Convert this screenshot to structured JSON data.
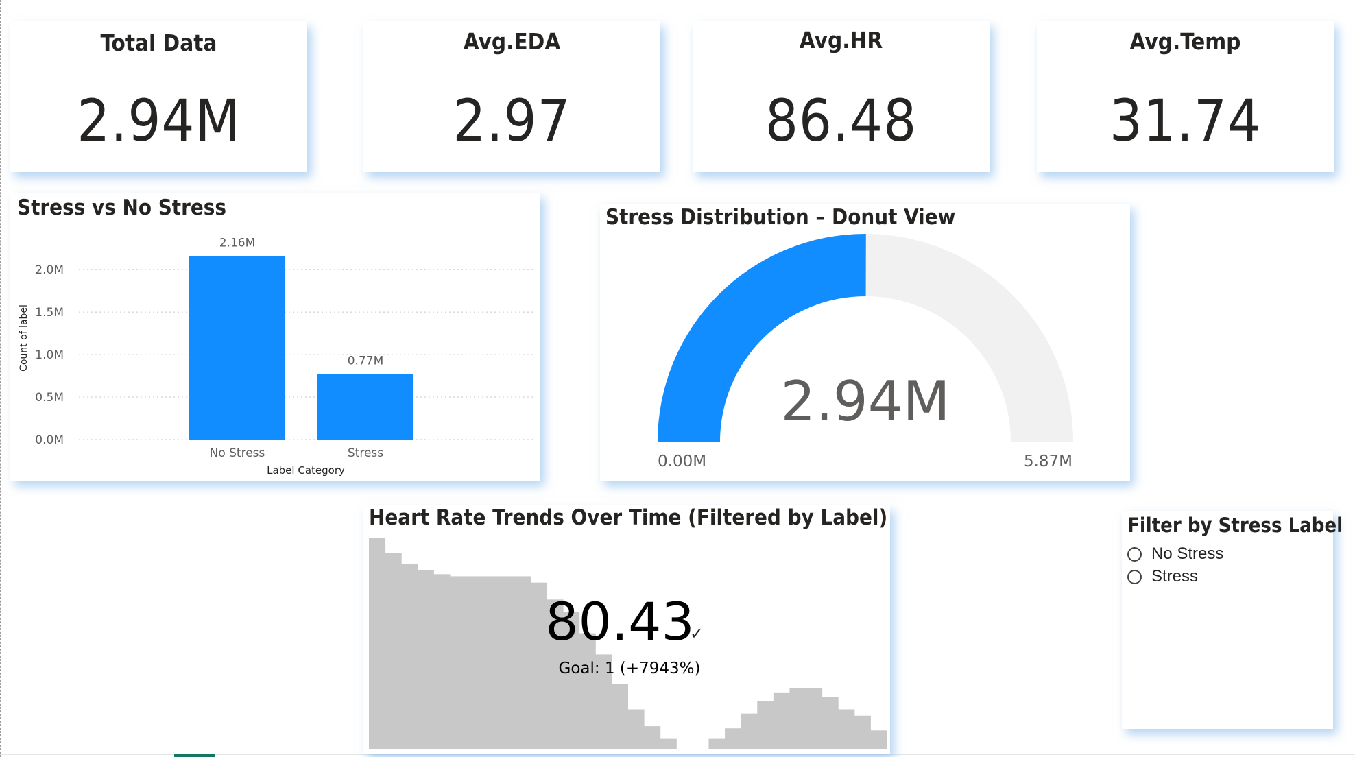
{
  "kpis": {
    "total": {
      "title": "Total Data",
      "value": "2.94M"
    },
    "eda": {
      "title": "Avg.EDA",
      "value": "2.97"
    },
    "hr": {
      "title": "Avg.HR",
      "value": "86.48"
    },
    "temp": {
      "title": "Avg.Temp",
      "value": "31.74"
    }
  },
  "bar_visual": {
    "title": "Stress vs No Stress"
  },
  "gauge_visual": {
    "title": "Stress Distribution – Donut View"
  },
  "trend_visual": {
    "title": "Heart Rate Trends Over Time (Filtered by Label)"
  },
  "slicer": {
    "title": "Filter by Stress Label",
    "options": [
      {
        "label": "No Stress",
        "selected": false
      },
      {
        "label": "Stress",
        "selected": false
      }
    ]
  },
  "colors": {
    "accent": "#118DFF",
    "gauge_track": "#F1F1F1",
    "area_fill": "#C8C8C8",
    "shadow": "#76B0E8"
  },
  "chart_data": [
    {
      "type": "bar",
      "title": "Stress vs No Stress",
      "xlabel": "Label Category",
      "ylabel": "Count of label",
      "categories": [
        "No Stress",
        "Stress"
      ],
      "values": [
        2160000,
        770000
      ],
      "data_labels": [
        "2.16M",
        "0.77M"
      ],
      "yticks": [
        0,
        500000,
        1000000,
        1500000,
        2000000
      ],
      "ytick_labels": [
        "0.0M",
        "0.5M",
        "1.0M",
        "1.5M",
        "2.0M"
      ],
      "ylim": [
        0,
        2300000
      ],
      "grid": true
    },
    {
      "type": "gauge",
      "title": "Stress Distribution – Donut View",
      "value": 2940000,
      "value_label": "2.94M",
      "min": 0,
      "max": 5870000,
      "min_label": "0.00M",
      "max_label": "5.87M"
    },
    {
      "type": "area",
      "title": "Heart Rate Trends Over Time (Filtered by Label)",
      "kpi_value": "80.43",
      "goal_label": "Goal: 1 (+7943%)",
      "indicator": "✓",
      "values": [
        100,
        93,
        88,
        85,
        83,
        82,
        82,
        82,
        82,
        82,
        79,
        71,
        65,
        55,
        45,
        31,
        19,
        11,
        5,
        0,
        null,
        5,
        10,
        17,
        23,
        27,
        29,
        29,
        25,
        19,
        16,
        9
      ]
    }
  ]
}
